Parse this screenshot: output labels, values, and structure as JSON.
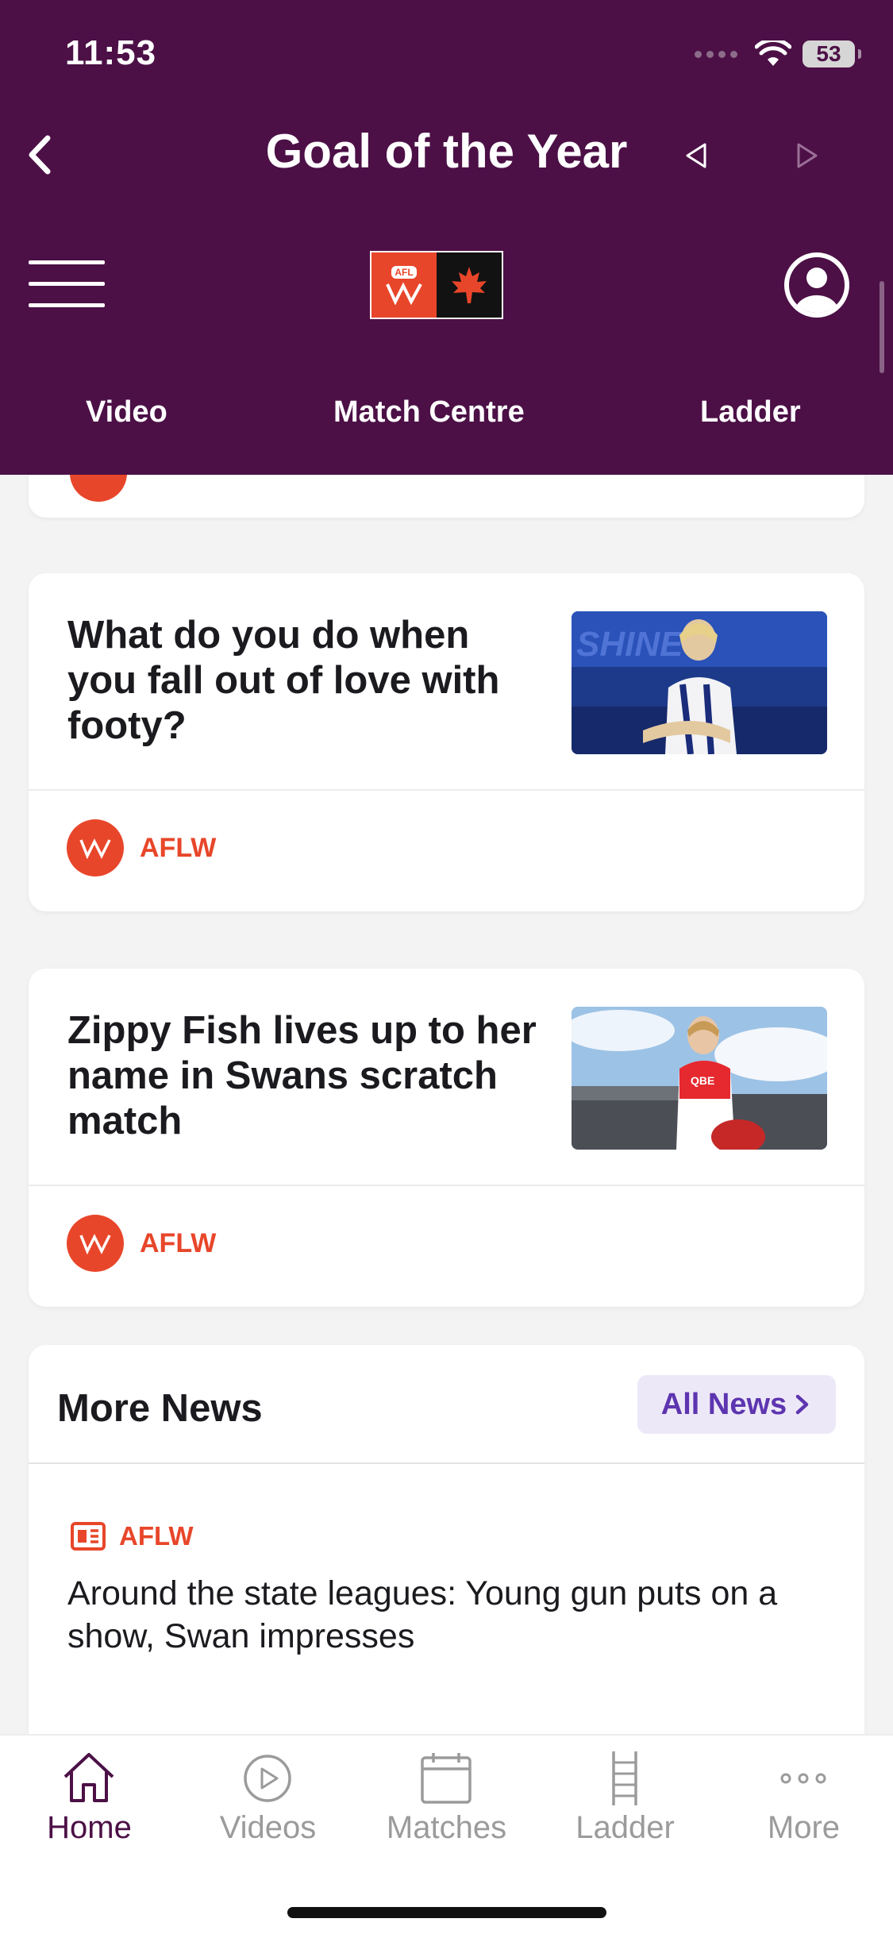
{
  "status_bar": {
    "time": "11:53",
    "battery": "53"
  },
  "header": {
    "title": "Goal of the Year",
    "logo_label": "AFL",
    "tabs": [
      "Video",
      "Match Centre",
      "Ladder"
    ]
  },
  "articles": [
    {
      "headline": "What do you do when you fall out of love with footy?",
      "tag": "AFLW",
      "thumb_text": "SHINE"
    },
    {
      "headline": "Zippy Fish lives up to her name in Swans scratch match",
      "tag": "AFLW",
      "thumb_text": "QBE"
    }
  ],
  "more_news": {
    "title": "More News",
    "button_label": "All News",
    "items": [
      {
        "tag": "AFLW",
        "title": "Around the state leagues: Young gun puts on a show, Swan impresses"
      }
    ]
  },
  "tabbar": {
    "items": [
      {
        "label": "Home",
        "icon": "home-icon"
      },
      {
        "label": "Videos",
        "icon": "play-icon"
      },
      {
        "label": "Matches",
        "icon": "calendar-icon"
      },
      {
        "label": "Ladder",
        "icon": "ladder-icon"
      },
      {
        "label": "More",
        "icon": "more-icon"
      }
    ]
  },
  "colors": {
    "header": "#4c1046",
    "aflw_orange": "#e8462a",
    "link_purple": "#5d35b0"
  }
}
